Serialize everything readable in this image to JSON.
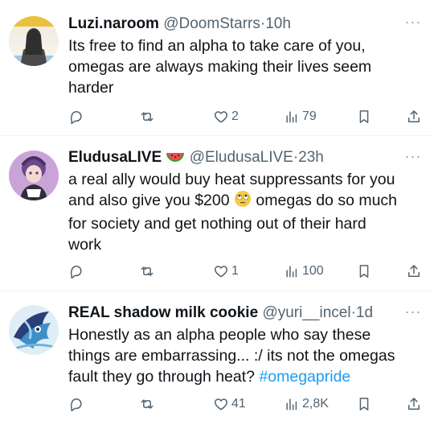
{
  "tweets": [
    {
      "display_name": "Luzi.naroom",
      "handle": "@DoomStarrs",
      "sep": "·",
      "time": "10h",
      "text_lines": [
        "Its free to find an alpha to take care of you,",
        "omegas are always making their lives seem",
        "harder"
      ],
      "replies": "",
      "retweets": "",
      "likes": "2",
      "views": "79"
    },
    {
      "display_name": "EludusaLIVE",
      "handle": "@EludusaLIVE",
      "sep": "·",
      "time": "23h",
      "name_emoji": "watermelon-icon",
      "text_line1": "a real ally would buy heat suppressants for you",
      "text_line2a": "and also give you $200",
      "text_line2_emoji": "rolling-eyes-emoji",
      "text_line2b": "omegas do so much",
      "text_line3": "for society and get nothing out of their hard",
      "text_line4": "work",
      "replies": "",
      "retweets": "",
      "likes": "1",
      "views": "100"
    },
    {
      "display_name": "REAL shadow milk cookie",
      "handle": "@yuri__incel",
      "sep": "·",
      "time": "1d",
      "text_line1": "Honestly as an alpha people who say these",
      "text_line2": "things are embarrassing... :/ its not the omegas",
      "text_line3a": "fault they go through heat?",
      "hashtag": "#omegapride",
      "replies": "",
      "retweets": "",
      "likes": "41",
      "views": "2,8K"
    }
  ],
  "more_label": "···",
  "colors": {
    "text": "#0f1419",
    "secondary": "#536471",
    "link": "#1d9bf0",
    "divider": "#eff3f4"
  },
  "icons": [
    "reply-icon",
    "retweet-icon",
    "like-icon",
    "views-icon",
    "bookmark-icon",
    "share-icon",
    "more-icon"
  ]
}
